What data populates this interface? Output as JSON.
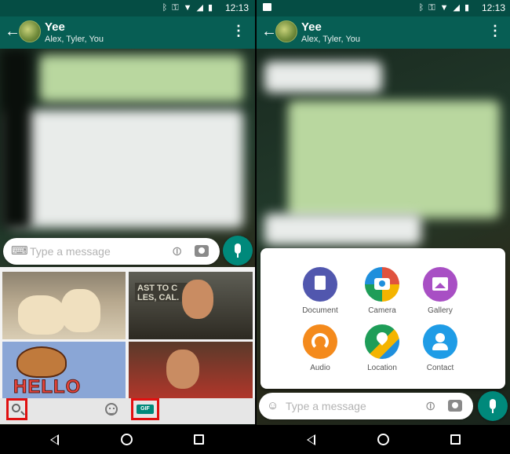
{
  "status_bar": {
    "time": "12:13"
  },
  "chat": {
    "title": "Yee",
    "subtitle": "Alex, Tyler, You"
  },
  "composer": {
    "placeholder": "Type a message"
  },
  "gif_panel": {
    "gif_badge": "GIF",
    "sign_text": "AST TO C\nLES, CAL.",
    "hello_text": "HELLO"
  },
  "attach_menu": {
    "items": [
      {
        "label": "Document",
        "color": "#5157ae"
      },
      {
        "label": "Camera",
        "color": "#e0523e"
      },
      {
        "label": "Gallery",
        "color": "#a84fc4"
      },
      {
        "label": "Audio",
        "color": "#f48a1c"
      },
      {
        "label": "Location",
        "color": "#1e9d58"
      },
      {
        "label": "Contact",
        "color": "#1f9ce6"
      }
    ]
  },
  "colors": {
    "status_bar": "#054d44",
    "app_bar": "#075e54",
    "accent": "#00897b",
    "highlight": "#e01010"
  },
  "icons": [
    "back-arrow-icon",
    "overflow-menu-icon",
    "keyboard-icon",
    "emoji-icon",
    "attach-icon",
    "camera-icon",
    "mic-icon",
    "search-icon",
    "gif-icon",
    "nav-back-icon",
    "nav-home-icon",
    "nav-recents-icon"
  ]
}
